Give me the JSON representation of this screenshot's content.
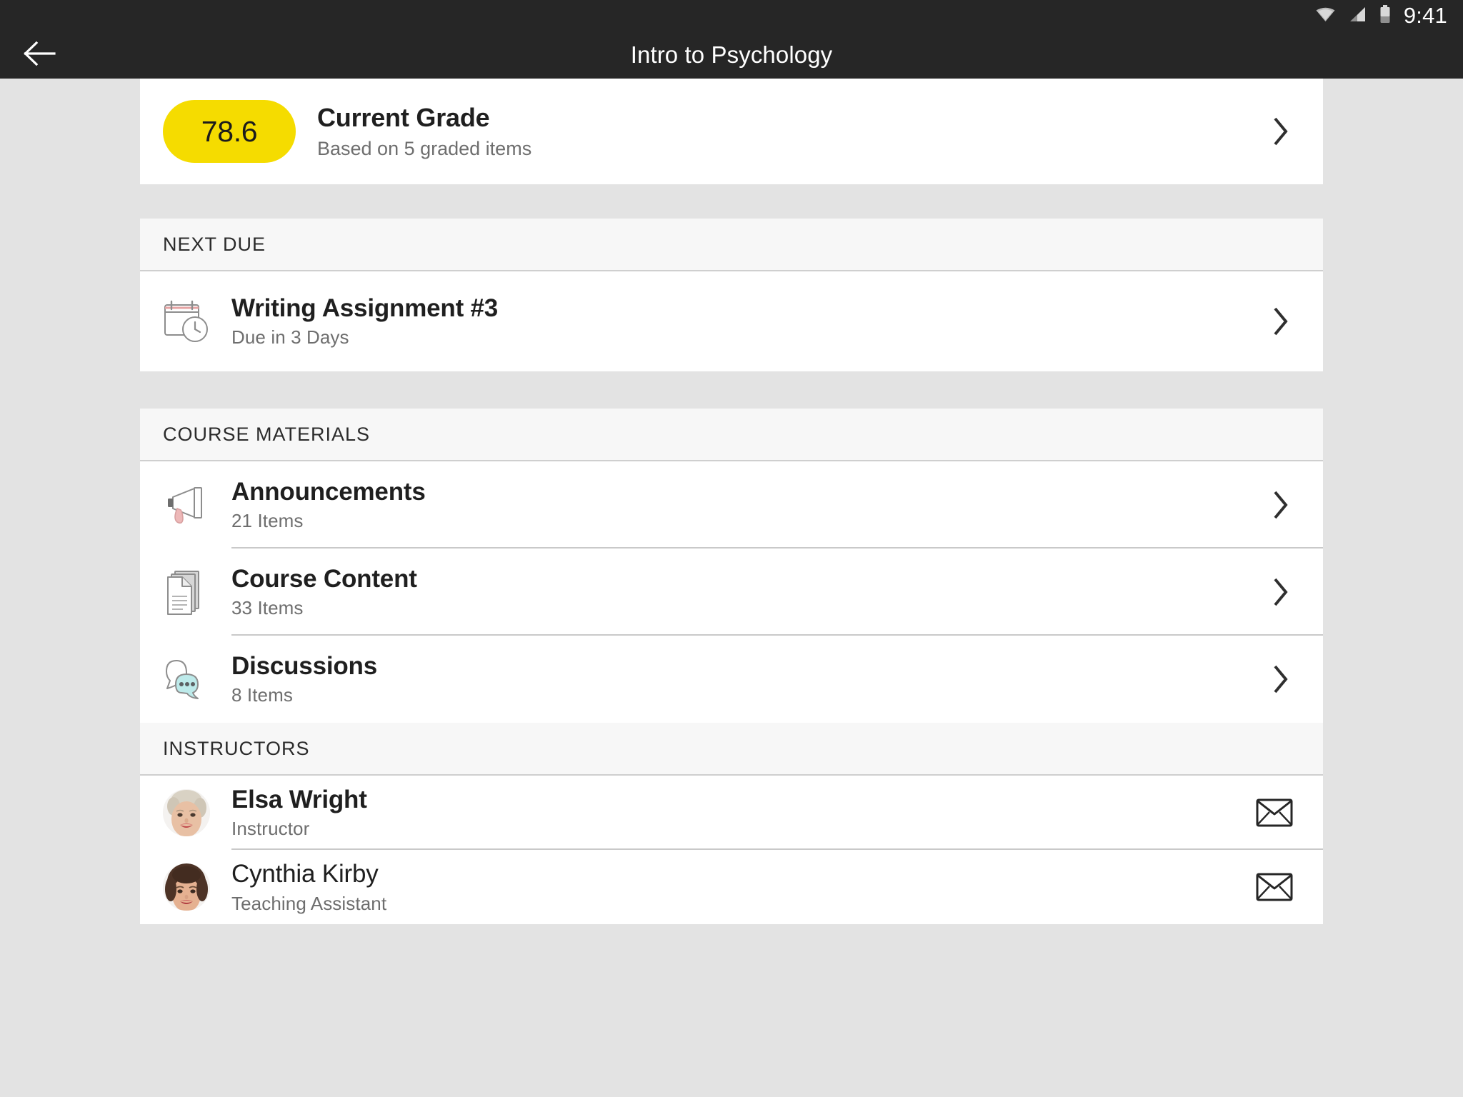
{
  "statusbar": {
    "time": "9:41",
    "icons": [
      "wifi-icon",
      "cellular-signal-icon",
      "battery-icon"
    ]
  },
  "appbar": {
    "back_icon": "back-arrow-icon",
    "title": "Intro to Psychology"
  },
  "grade": {
    "value": "78.6",
    "title": "Current Grade",
    "subtitle": "Based on 5 graded items",
    "pill_color": "#f5dc00",
    "chevron": "chevron-right-icon"
  },
  "next_due": {
    "header": "NEXT DUE",
    "items": [
      {
        "icon": "calendar-clock-icon",
        "title": "Writing Assignment #3",
        "subtitle": "Due in 3 Days",
        "chevron": "chevron-right-icon"
      }
    ]
  },
  "course_materials": {
    "header": "COURSE MATERIALS",
    "items": [
      {
        "icon": "megaphone-icon",
        "title": "Announcements",
        "subtitle": "21 Items",
        "chevron": "chevron-right-icon"
      },
      {
        "icon": "documents-icon",
        "title": "Course Content",
        "subtitle": "33 Items",
        "chevron": "chevron-right-icon"
      },
      {
        "icon": "speech-bubbles-icon",
        "title": "Discussions",
        "subtitle": "8 Items",
        "chevron": "chevron-right-icon"
      }
    ]
  },
  "instructors": {
    "header": "INSTRUCTORS",
    "items": [
      {
        "avatar": "avatar-elsa-wright",
        "name": "Elsa Wright",
        "role": "Instructor",
        "action_icon": "envelope-icon"
      },
      {
        "avatar": "avatar-cynthia-kirby",
        "name": "Cynthia Kirby",
        "role": "Teaching Assistant",
        "action_icon": "envelope-icon"
      }
    ]
  },
  "colors": {
    "appbar_bg": "#262626",
    "page_bg": "#e3e3e3",
    "card_bg": "#ffffff",
    "section_header_bg": "#f7f7f7",
    "accent_yellow": "#f5dc00",
    "megaphone_pink": "#edb8b8",
    "bubble_cyan": "#bdeaea"
  }
}
